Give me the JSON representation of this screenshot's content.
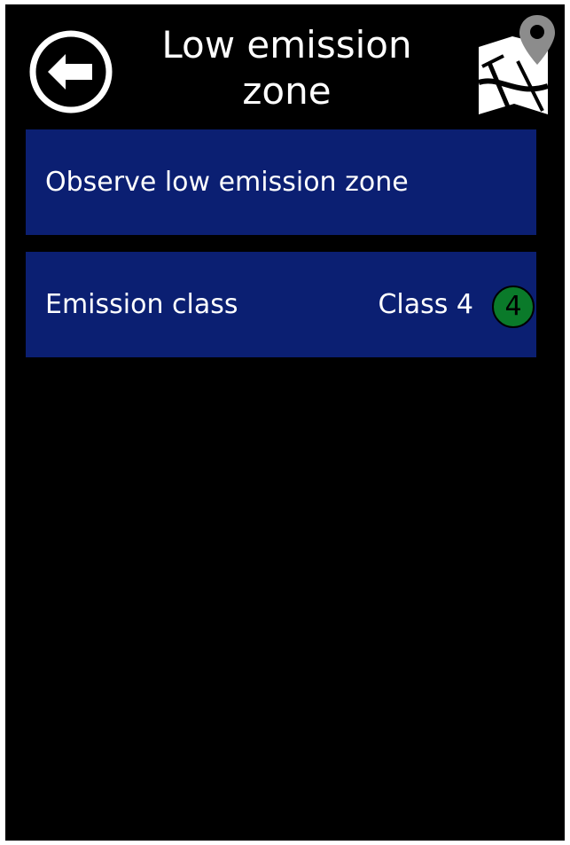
{
  "header": {
    "title": "Low emission zone",
    "back_icon": "back-arrow-icon",
    "map_icon": "map-pin-icon"
  },
  "rows": [
    {
      "label": "Observe low emission zone"
    },
    {
      "label": "Emission class",
      "value": "Class 4",
      "badge": "4",
      "badge_color": "#0a7a2a"
    }
  ],
  "colors": {
    "background": "#000000",
    "row_background": "#0b1f72",
    "text": "#ffffff"
  }
}
